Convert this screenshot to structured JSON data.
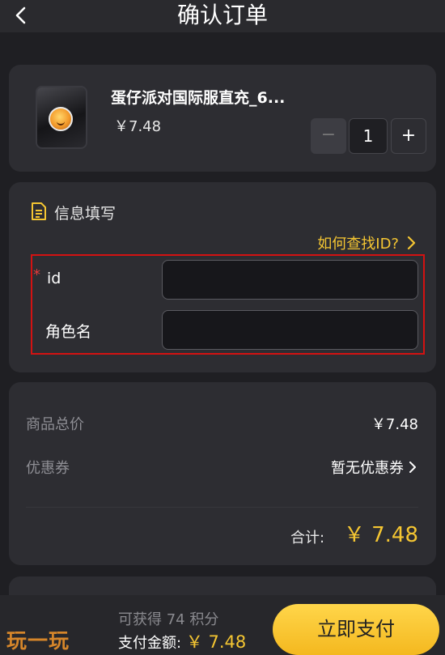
{
  "header": {
    "title": "确认订单",
    "back_icon": "chevron-left-icon"
  },
  "product": {
    "name": "蛋仔派对国际服直充_6...",
    "price": "￥7.48",
    "thumbnail_icon": "product-coin-icon",
    "quantity": {
      "minus_label": "−",
      "value": "1",
      "plus_label": "+"
    }
  },
  "info": {
    "title": "信息填写",
    "title_icon": "document-icon",
    "help_link": "如何查找ID?",
    "required_mark": "*",
    "fields": [
      {
        "label": "id",
        "value": "",
        "placeholder": "",
        "required": true
      },
      {
        "label": "角色名",
        "value": "",
        "placeholder": "",
        "required": false
      }
    ]
  },
  "summary": {
    "subtotal_label": "商品总价",
    "subtotal_value": "￥7.48",
    "coupon_label": "优惠券",
    "coupon_value": "暂无优惠券",
    "total_label": "合计:",
    "total_value": "￥ 7.48"
  },
  "footer": {
    "points_text": "可获得 74 积分",
    "pay_label": "支付金额:",
    "pay_amount": "￥ 7.48",
    "pay_button": "立即支付"
  },
  "watermark": "玩一玩",
  "colors": {
    "accent": "#f5c632",
    "highlight_border": "#d31212",
    "background": "#1f1f23",
    "card": "#2d2d32"
  }
}
